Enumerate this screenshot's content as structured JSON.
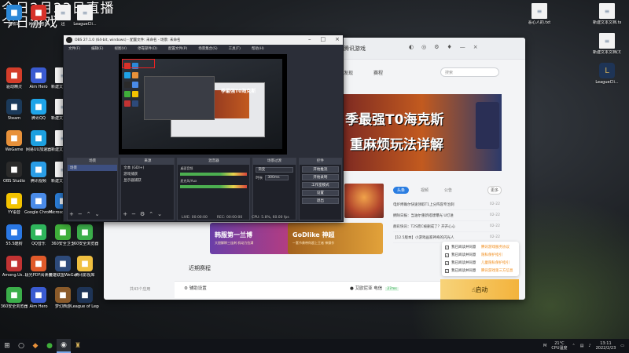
{
  "overlay": {
    "line1": "今日2月23日直播",
    "line2": "今日游戏"
  },
  "desktop_icons": [
    {
      "label": "回收站",
      "icon": "recycle-bin-icon",
      "color": "#2b88d8"
    },
    {
      "label": "网易云音乐",
      "icon": "netease-music-icon",
      "color": "#d7322a"
    },
    {
      "label": "迅",
      "icon": "document-icon",
      "color": "#f2f2f2"
    },
    {
      "label": "LeagueCli...",
      "icon": "document-icon",
      "color": "#f2f2f2"
    },
    {
      "label": "驱动精灵",
      "icon": "driver-icon",
      "color": "#d43d2a"
    },
    {
      "label": "Aim Hero",
      "icon": "aim-hero-icon",
      "color": "#3a5bd1"
    },
    {
      "label": "新建文本文档",
      "icon": "document-icon",
      "color": "#f2f2f2"
    },
    {
      "label": "Steam",
      "icon": "steam-icon",
      "color": "#1b3a5a"
    },
    {
      "label": "腾讯QQ",
      "icon": "qq-icon",
      "color": "#1fa4e8"
    },
    {
      "label": "新建文本文档",
      "icon": "document-icon",
      "color": "#f2f2f2"
    },
    {
      "label": "WeGame",
      "icon": "wegame-icon",
      "color": "#e8913a"
    },
    {
      "label": "网易UU加速器",
      "icon": "uu-icon",
      "color": "#1da0e0"
    },
    {
      "label": "新建文本文档",
      "icon": "document-icon",
      "color": "#f2f2f2"
    },
    {
      "label": "OBS Studio",
      "icon": "obs-icon",
      "color": "#2a2a2a"
    },
    {
      "label": "腾讯视频",
      "icon": "tencent-video-icon",
      "color": "#2a9de6"
    },
    {
      "label": "新建文本文档",
      "icon": "document-icon",
      "color": "#f2f2f2"
    },
    {
      "label": "YY语音",
      "icon": "yy-icon",
      "color": "#f3c300"
    },
    {
      "label": "Google Chrome",
      "icon": "chrome-icon",
      "color": "#4a8be8"
    },
    {
      "label": "Microsoft Edge",
      "icon": "edge-icon",
      "color": "#2a7bd3"
    },
    {
      "label": "55.5酷狗",
      "icon": "kugou-icon",
      "color": "#2a78e4"
    },
    {
      "label": "QQ音乐",
      "icon": "qq-music-icon",
      "color": "#2fb55c"
    },
    {
      "label": "360安全卫士",
      "icon": "360-guard-icon",
      "color": "#3fae3a"
    },
    {
      "label": "360安全浏览器",
      "icon": "360-browser-icon",
      "color": "#3bae4a"
    },
    {
      "label": "Among.Us...",
      "icon": "among-us-icon",
      "color": "#c23333"
    },
    {
      "label": "极光PDF阅读器",
      "icon": "pdf-icon",
      "color": "#e05a2a"
    },
    {
      "label": "英雄联盟WeGame版",
      "icon": "lol-wegame-icon",
      "color": "#2d4a7a"
    },
    {
      "label": "腾讯影视库",
      "icon": "folder-icon",
      "color": "#f0c040"
    },
    {
      "label": "360安全浏览器",
      "icon": "360-browser-icon",
      "color": "#3bae4a"
    },
    {
      "label": "Aim Hero",
      "icon": "aim-hero-icon",
      "color": "#3a5bd1"
    },
    {
      "label": "梦幻西游",
      "icon": "game-icon",
      "color": "#8a5a2a"
    },
    {
      "label": "League of Legends",
      "icon": "lol-icon",
      "color": "#1e3456"
    }
  ],
  "right_icons": [
    {
      "label": "恶心人的.txt",
      "icon": "document-icon"
    },
    {
      "label": "新建文本文档.txt",
      "icon": "document-icon"
    },
    {
      "label": "新建文本文档(3).txt",
      "icon": "document-icon"
    },
    {
      "label": "LeagueCli...",
      "icon": "lol-icon"
    }
  ],
  "client": {
    "brand": "腾讯游戏",
    "nav": [
      "发现",
      "赛程"
    ],
    "search_placeholder": "搜索",
    "banner_line1": "季最强T0海克斯",
    "banner_line2": "重麻烦玩法详解",
    "news_tabs": [
      "头条",
      "视频",
      "公告"
    ],
    "more": "更多",
    "news": [
      {
        "text": "电炉烤确尔快速领取T1上分阵容专治刺",
        "date": "02-22"
      },
      {
        "text": "拥除日报：当油尔重新搭建曝光 U灯进",
        "date": "02-22"
      },
      {
        "text": "赫彩快讯：T2S而C被删成了？开开心心",
        "date": "02-22"
      },
      {
        "text": "【12.5版本】小游戏画家神奇的闪光人",
        "date": "02-22"
      }
    ],
    "promo1_title": "韩服第一兰博",
    "promo1_sub": "大胆解释三连刺 机动力拉满",
    "promo2_title": "GoDlike 神超",
    "promo2_sub": "一套节奏带你超上王者 神操作",
    "recent": "近期赛程",
    "assist": "辅助设置",
    "server": "艾欧尼亚 电信",
    "ping": "27ms",
    "launch": "启动",
    "bottom_left": "共43个应用",
    "checklist": [
      {
        "left": "我已阅读并同意",
        "right": "腾讯游戏服务协议"
      },
      {
        "left": "我已阅读并同意",
        "right": "隐私保护指引"
      },
      {
        "left": "我已阅读并同意",
        "right": "儿童隐私保护指引"
      },
      {
        "left": "我已阅读并同意",
        "right": "腾讯游戏第三方信息"
      }
    ]
  },
  "obs": {
    "title": "OBS 27.1.0 (64-bit, windows) - 配置文件: 未命名 - 场景: 未命名",
    "menu": [
      "文件(F)",
      "编辑(E)",
      "视图(V)",
      "停靠部件(D)",
      "配置文件(P)",
      "场景集合(S)",
      "工具(T)",
      "帮助(H)"
    ],
    "nested_title": "季最强T0海克斯",
    "docks": {
      "scenes": {
        "header": "场景",
        "items": [
          "场景"
        ]
      },
      "sources": {
        "header": "来源",
        "items": [
          "文本 (GDI+)",
          "游戏捕获",
          "显示器捕获"
        ]
      },
      "mixer": {
        "header": "混音器",
        "rows": [
          "桌面音频",
          "麦克风/Aux"
        ]
      },
      "transitions": {
        "header": "场景过渡",
        "type": "渐变",
        "duration_label": "时长",
        "duration": "300ms"
      },
      "controls": {
        "header": "控件",
        "buttons": [
          "开始推流",
          "开始录制",
          "工作室模式",
          "设置",
          "退出"
        ]
      }
    },
    "status": [
      "LIVE: 00:00:00",
      "REC: 00:00:00",
      "CPU: 5.8%, 60.00 fps"
    ]
  },
  "taskbar": {
    "items": [
      "windows-start-icon",
      "search-icon",
      "wegame-taskbar-icon",
      "qq-taskbar-icon",
      "obs-taskbar-icon",
      "lol-taskbar-icon"
    ],
    "weather": "21°C",
    "weather_sub": "CPU温度",
    "time": "13:11",
    "date": "2022/2/23",
    "ime": "M"
  }
}
